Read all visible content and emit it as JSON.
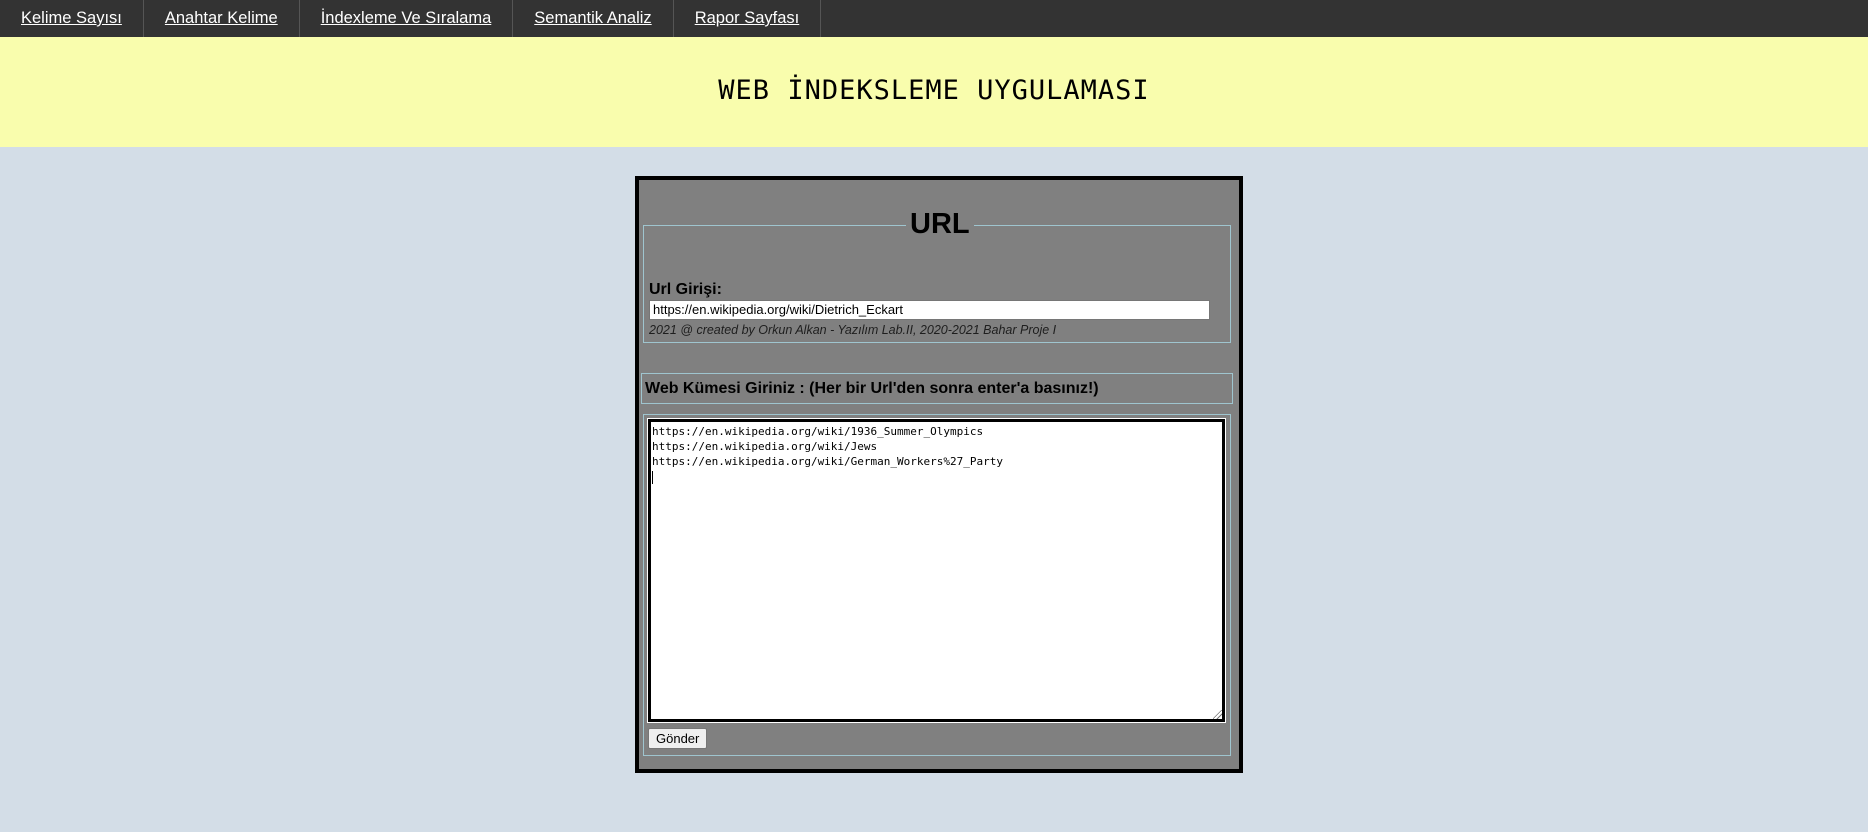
{
  "nav": {
    "items": [
      {
        "label": "Kelime Sayısı"
      },
      {
        "label": "Anahtar Kelime"
      },
      {
        "label": "İndexleme Ve Sıralama"
      },
      {
        "label": "Semantik Analiz"
      },
      {
        "label": "Rapor Sayfası"
      }
    ]
  },
  "banner": {
    "title": "WEB İNDEKSLEME UYGULAMASI"
  },
  "url_section": {
    "legend": "URL",
    "label": "Url Girişi:",
    "input_value": "https://en.wikipedia.org/wiki/Dietrich_Eckart",
    "credit": "2021 @ created by Orkun Alkan - Yazılım Lab.II, 2020-2021 Bahar Proje I"
  },
  "web_section": {
    "label": "Web Kümesi Giriniz : (Her bir Url'den sonra enter'a basınız!)",
    "lines": [
      "https://en.wikipedia.org/wiki/1936_Summer_Olympics",
      "https://en.wikipedia.org/wiki/Jews",
      "https://en.wikipedia.org/wiki/German_Workers%27_Party"
    ],
    "submit_label": "Gönder"
  },
  "colors": {
    "nav_bg": "#333333",
    "banner_bg": "#f9fdad",
    "page_bg": "#d3dde7",
    "panel_bg": "#808080"
  }
}
